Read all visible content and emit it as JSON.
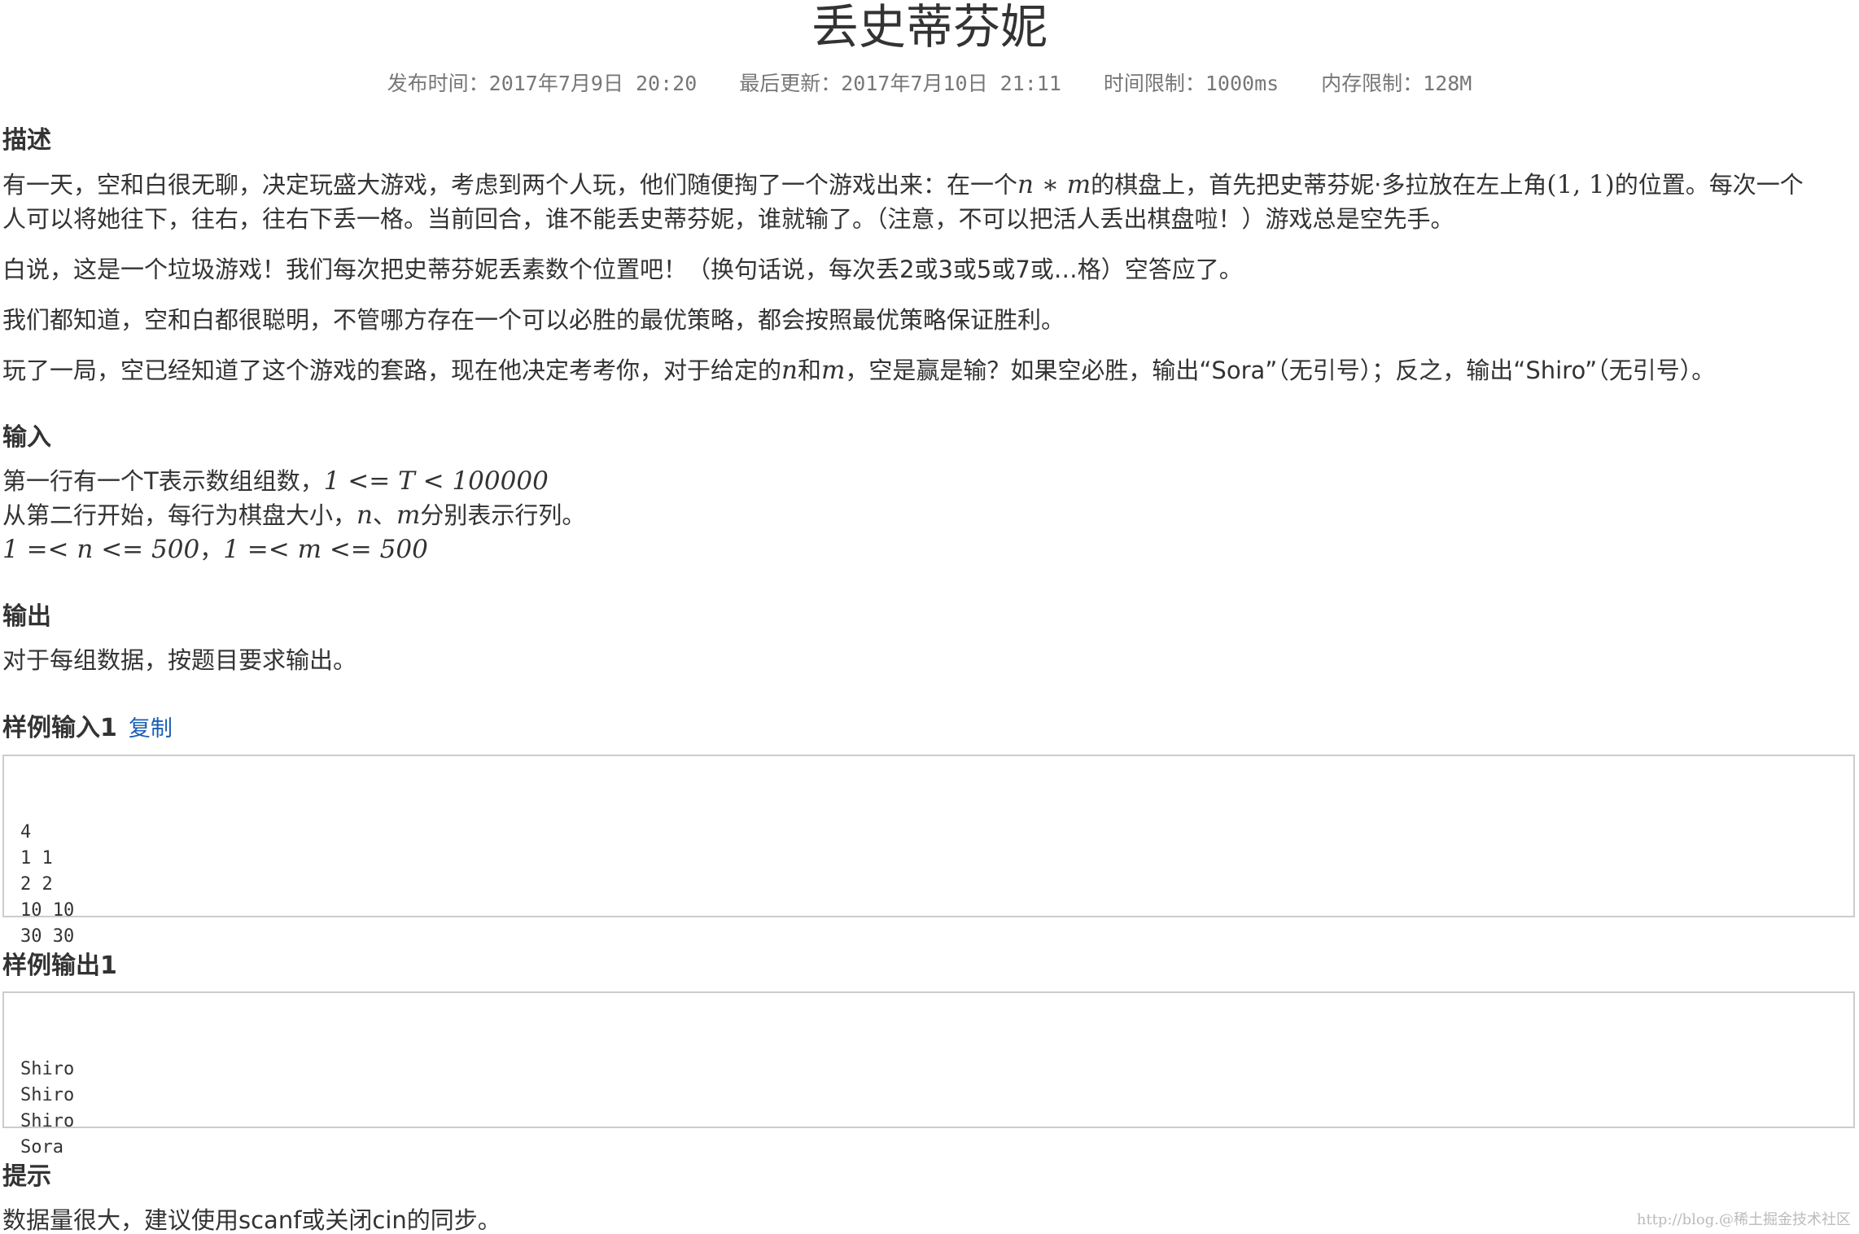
{
  "title": "丢史蒂芬妮",
  "meta": {
    "publish_label": "发布时间：",
    "publish_value": "2017年7月9日 20:20",
    "update_label": "最后更新：",
    "update_value": "2017年7月10日 21:11",
    "time_label": "时间限制：",
    "time_value": "1000ms",
    "memory_label": "内存限制：",
    "memory_value": "128M"
  },
  "description": {
    "heading": "描述",
    "p1_a": "有一天，空和白很无聊，决定玩盛大游戏，考虑到两个人玩，他们随便掏了一个游戏出来：在一个",
    "p1_math1": "n ∗ m",
    "p1_b": "的棋盘上，首先把史蒂芬妮·多拉放在左上角",
    "p1_math2": "(1, 1)",
    "p1_c": "的位置。每次一个",
    "p1_line2": "人可以将她往下，往右，往右下丢一格。当前回合，谁不能丢史蒂芬妮，谁就输了。（注意，不可以把活人丢出棋盘啦！）游戏总是空先手。",
    "p2": "白说，这是一个垃圾游戏！我们每次把史蒂芬妮丢素数个位置吧！（换句话说，每次丢2或3或5或7或…格）空答应了。",
    "p3": "我们都知道，空和白都很聪明，不管哪方存在一个可以必胜的最优策略，都会按照最优策略保证胜利。",
    "p4_a": "玩了一局，空已经知道了这个游戏的套路，现在他决定考考你，对于给定的",
    "p4_n": "n",
    "p4_b": "和",
    "p4_m": "m",
    "p4_c": "，空是赢是输？如果空必胜，输出“Sora”（无引号）；反之，输出“Shiro”（无引号）。"
  },
  "input": {
    "heading": "输入",
    "line1_a": "第一行有一个T表示数组组数，",
    "line1_math": "1 <= T < 100000",
    "line2_a": "从第二行开始，每行为棋盘大小，",
    "line2_n": "n",
    "line2_sep": "、",
    "line2_m": "m",
    "line2_b": "分别表示行列。",
    "line3_math1": "1 =< n <= 500",
    "line3_sep": "，",
    "line3_math2": "1 =< m <= 500"
  },
  "output": {
    "heading": "输出",
    "text": "对于每组数据，按题目要求输出。"
  },
  "sample_input": {
    "heading": "样例输入1",
    "copy_label": "复制",
    "lines": [
      "4",
      "1 1",
      "2 2",
      "10 10",
      "30 30"
    ]
  },
  "sample_output": {
    "heading": "样例输出1",
    "lines": [
      "Shiro",
      "Shiro",
      "Shiro",
      "Sora"
    ]
  },
  "hint": {
    "heading": "提示",
    "text": "数据量很大，建议使用scanf或关闭cin的同步。"
  },
  "watermark": "http://blog.@稀土掘金技术社区"
}
